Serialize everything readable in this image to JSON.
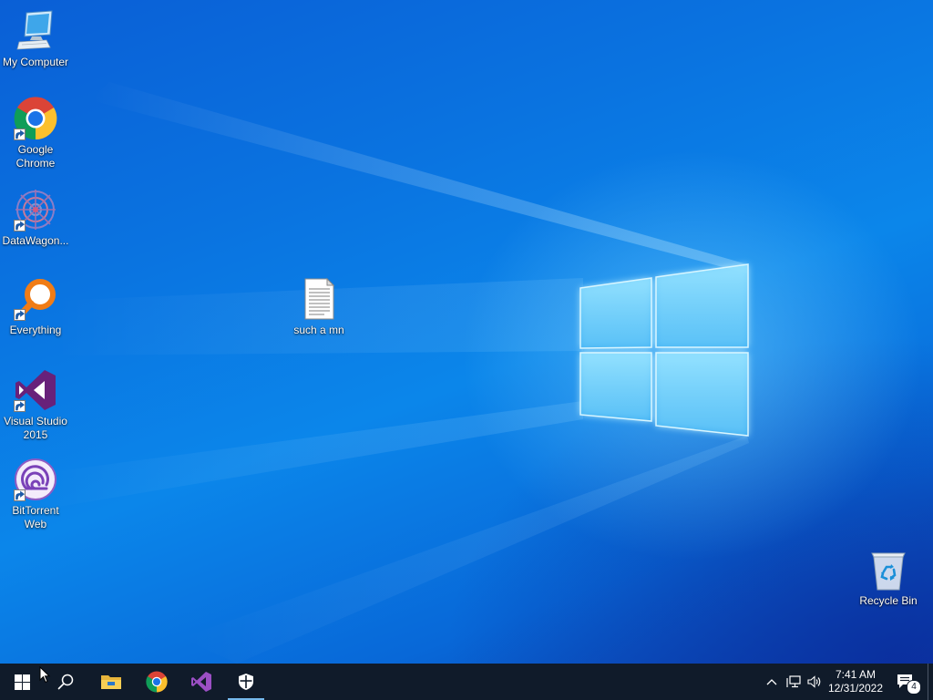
{
  "desktop": {
    "icons": [
      {
        "label": "My Computer",
        "icon": "computer-icon",
        "shortcut": false
      },
      {
        "label": "Google Chrome",
        "icon": "chrome-icon",
        "shortcut": true
      },
      {
        "label": "DataWagon...",
        "icon": "datawagon-icon",
        "shortcut": true
      },
      {
        "label": "Everything",
        "icon": "everything-search-icon",
        "shortcut": true
      },
      {
        "label": "Visual Studio 2015",
        "icon": "visual-studio-icon",
        "shortcut": true
      },
      {
        "label": "BitTorrent Web",
        "icon": "bittorrent-icon",
        "shortcut": true
      },
      {
        "label": "such a mn",
        "icon": "text-file-icon",
        "shortcut": false
      },
      {
        "label": "Recycle Bin",
        "icon": "recycle-bin-icon",
        "shortcut": false
      }
    ]
  },
  "taskbar": {
    "start": {
      "icon": "windows-start-icon"
    },
    "search": {
      "icon": "search-icon"
    },
    "pinned": [
      {
        "name": "File Explorer",
        "icon": "folder-icon",
        "active": false
      },
      {
        "name": "Google Chrome",
        "icon": "chrome-icon",
        "active": false
      },
      {
        "name": "Visual Studio",
        "icon": "visual-studio-icon",
        "active": false
      },
      {
        "name": "Windows Security",
        "icon": "shield-icon",
        "active": true
      }
    ],
    "tray": {
      "icons": [
        "chevron-up-icon",
        "network-icon",
        "volume-icon"
      ],
      "time": "7:41 AM",
      "date": "12/31/2022",
      "notifications_icon": "action-center-icon",
      "notification_count": "4"
    }
  },
  "colors": {
    "taskbar_bg": "#101b2a",
    "desktop_accent": "#0b78e3",
    "active_indicator": "#76b9ed"
  }
}
